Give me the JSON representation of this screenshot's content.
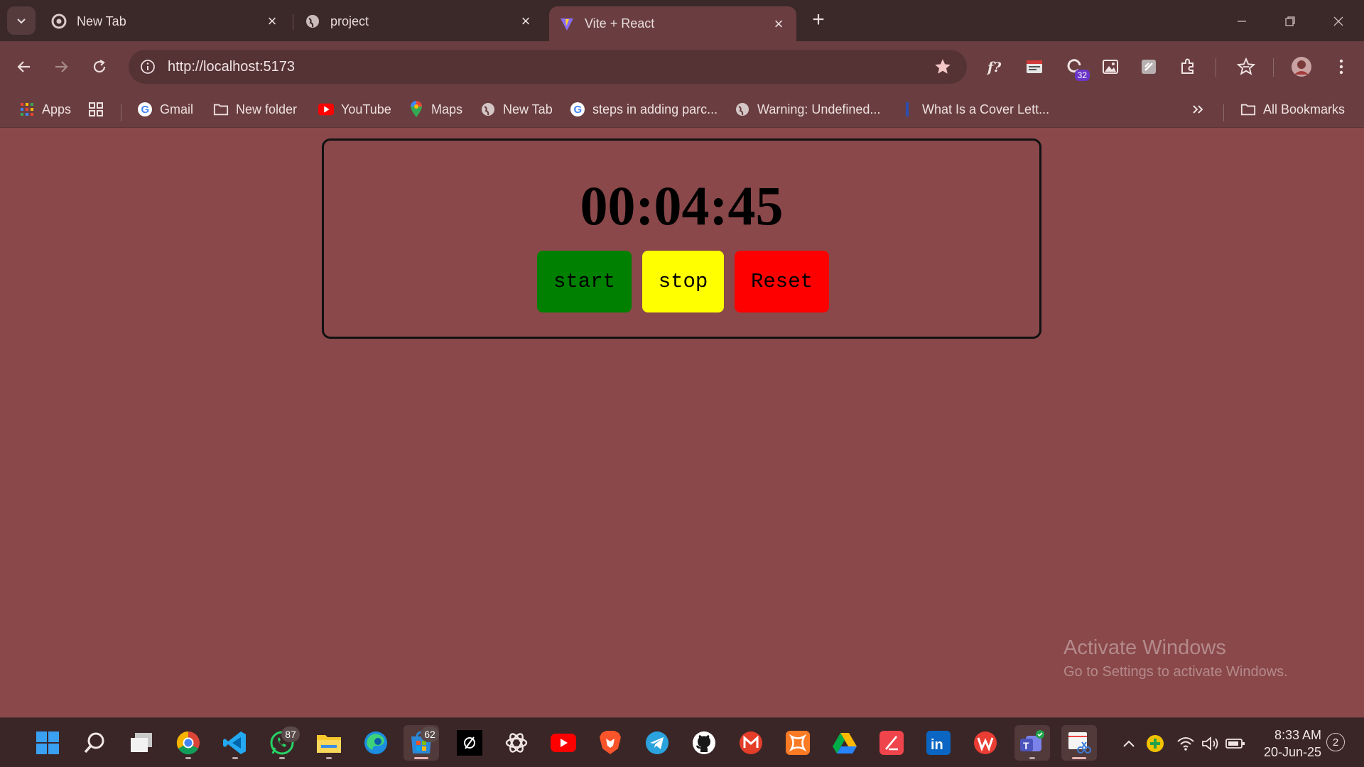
{
  "browser": {
    "tabs": [
      {
        "title": "New Tab",
        "icon": "chrome-icon",
        "active": false
      },
      {
        "title": "project",
        "icon": "globe-icon",
        "active": false
      },
      {
        "title": "Vite + React",
        "icon": "vite-icon",
        "active": true
      }
    ],
    "address": "http://localhost:5173",
    "extensions": [
      "function-icon",
      "snippet-icon",
      "refresh-badge-icon",
      "image-icon",
      "note-icon",
      "puzzle-icon",
      "bookmark-star-icon",
      "profile-avatar"
    ],
    "extension_badge": "32",
    "bookmarks": [
      {
        "label": "Apps",
        "icon": "apps-grid-icon"
      },
      {
        "label": "",
        "icon": "tab-groups-icon"
      },
      {
        "label": "Gmail",
        "icon": "google-icon"
      },
      {
        "label": "New folder",
        "icon": "folder-icon"
      },
      {
        "label": "YouTube",
        "icon": "youtube-icon"
      },
      {
        "label": "Maps",
        "icon": "maps-icon"
      },
      {
        "label": "New Tab",
        "icon": "globe-icon"
      },
      {
        "label": "steps in adding parc...",
        "icon": "google-icon"
      },
      {
        "label": "Warning: Undefined...",
        "icon": "globe-icon"
      },
      {
        "label": "What Is a Cover Lett...",
        "icon": "bookmark-page-icon"
      }
    ],
    "all_bookmarks": "All Bookmarks"
  },
  "stopwatch": {
    "time": "00:04:45",
    "start_label": "start",
    "stop_label": "stop",
    "reset_label": "Reset",
    "colors": {
      "start": "#008000",
      "stop": "#ffff00",
      "reset": "#ff0000",
      "background": "#8a484a"
    }
  },
  "watermark": {
    "title": "Activate Windows",
    "subtitle": "Go to Settings to activate Windows."
  },
  "taskbar": {
    "apps": [
      "windows-start-icon",
      "search-icon",
      "task-view-icon",
      "chrome-icon",
      "vscode-icon",
      "whatsapp-icon",
      "file-explorer-icon",
      "edge-icon",
      "store-icon",
      "notion-icon",
      "chatgpt-icon",
      "youtube-icon",
      "brave-icon",
      "telegram-icon",
      "github-icon",
      "gmail-icon",
      "xampp-icon",
      "drive-icon",
      "pdf-icon",
      "linkedin-icon",
      "wps-icon",
      "teams-icon",
      "snipping-tool-icon"
    ],
    "badges": {
      "whatsapp": "87",
      "store": "62"
    },
    "clock_time": "8:33 AM",
    "clock_date": "20-Jun-25",
    "notifications": "2"
  }
}
